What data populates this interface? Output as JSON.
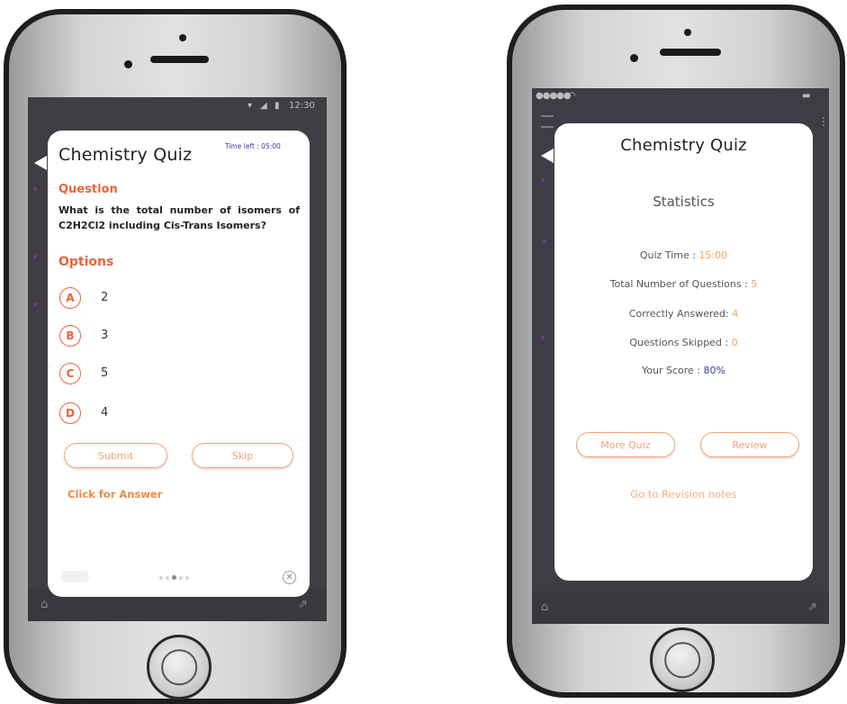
{
  "colors": {
    "accent": "#e8643c",
    "button_text": "#f2a37a",
    "stat_value": "#f7a35a",
    "score_value": "#3c3c9c",
    "timer": "#3b3b9a"
  },
  "left_screen": {
    "status_time": "12:30",
    "card": {
      "title": "Chemistry Quiz",
      "timer": "Time left : 05:00",
      "question_label": "Question",
      "question_text": "What is the total number of isomers of C2H2Cl2 including Cis-Trans Isomers?",
      "options_label": "Options",
      "options": [
        {
          "letter": "A",
          "value": "2"
        },
        {
          "letter": "B",
          "value": "3"
        },
        {
          "letter": "C",
          "value": "5"
        },
        {
          "letter": "D",
          "value": "4"
        }
      ],
      "submit_label": "Submit",
      "skip_label": "Skip",
      "answer_link": "Click for Answer",
      "close_icon": "close-circle-icon"
    }
  },
  "right_screen": {
    "card": {
      "title": "Chemistry Quiz",
      "heading": "Statistics",
      "stats": [
        {
          "label": "Quiz Time : ",
          "value": "15:00"
        },
        {
          "label": "Total Number of Questions : ",
          "value": "5"
        },
        {
          "label": "Correctly Answered: ",
          "value": "4"
        },
        {
          "label": "Questions Skipped : ",
          "value": "0"
        },
        {
          "label": "Your Score : ",
          "value": "80%"
        }
      ],
      "more_quiz_label": "More Quiz",
      "review_label": "Review",
      "revision_link": "Go to Revision notes"
    }
  }
}
